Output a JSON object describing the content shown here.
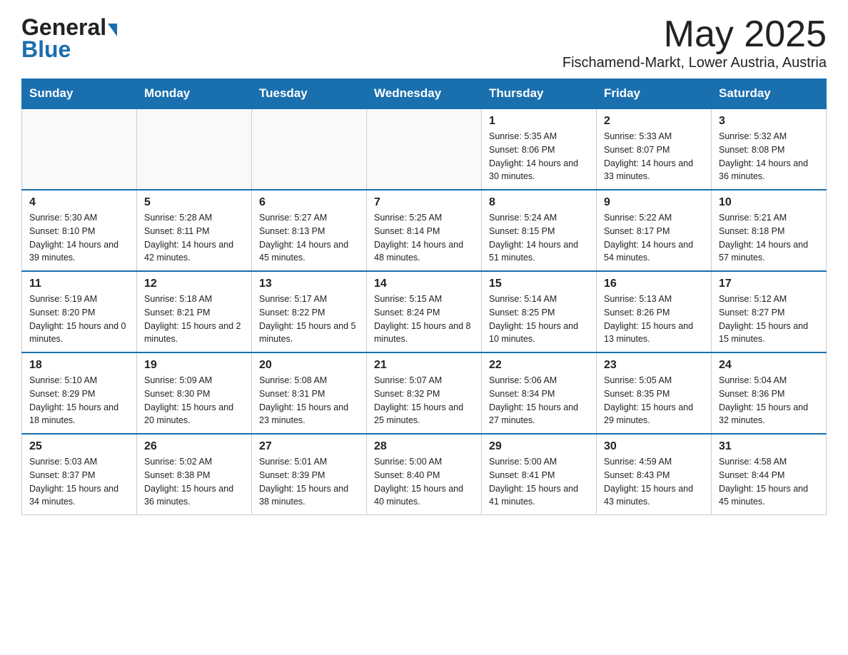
{
  "logo": {
    "general": "General",
    "arrow": "▶",
    "blue": "Blue"
  },
  "header": {
    "month_year": "May 2025",
    "location": "Fischamend-Markt, Lower Austria, Austria"
  },
  "weekdays": [
    "Sunday",
    "Monday",
    "Tuesday",
    "Wednesday",
    "Thursday",
    "Friday",
    "Saturday"
  ],
  "weeks": [
    [
      {
        "day": "",
        "info": ""
      },
      {
        "day": "",
        "info": ""
      },
      {
        "day": "",
        "info": ""
      },
      {
        "day": "",
        "info": ""
      },
      {
        "day": "1",
        "info": "Sunrise: 5:35 AM\nSunset: 8:06 PM\nDaylight: 14 hours and 30 minutes."
      },
      {
        "day": "2",
        "info": "Sunrise: 5:33 AM\nSunset: 8:07 PM\nDaylight: 14 hours and 33 minutes."
      },
      {
        "day": "3",
        "info": "Sunrise: 5:32 AM\nSunset: 8:08 PM\nDaylight: 14 hours and 36 minutes."
      }
    ],
    [
      {
        "day": "4",
        "info": "Sunrise: 5:30 AM\nSunset: 8:10 PM\nDaylight: 14 hours and 39 minutes."
      },
      {
        "day": "5",
        "info": "Sunrise: 5:28 AM\nSunset: 8:11 PM\nDaylight: 14 hours and 42 minutes."
      },
      {
        "day": "6",
        "info": "Sunrise: 5:27 AM\nSunset: 8:13 PM\nDaylight: 14 hours and 45 minutes."
      },
      {
        "day": "7",
        "info": "Sunrise: 5:25 AM\nSunset: 8:14 PM\nDaylight: 14 hours and 48 minutes."
      },
      {
        "day": "8",
        "info": "Sunrise: 5:24 AM\nSunset: 8:15 PM\nDaylight: 14 hours and 51 minutes."
      },
      {
        "day": "9",
        "info": "Sunrise: 5:22 AM\nSunset: 8:17 PM\nDaylight: 14 hours and 54 minutes."
      },
      {
        "day": "10",
        "info": "Sunrise: 5:21 AM\nSunset: 8:18 PM\nDaylight: 14 hours and 57 minutes."
      }
    ],
    [
      {
        "day": "11",
        "info": "Sunrise: 5:19 AM\nSunset: 8:20 PM\nDaylight: 15 hours and 0 minutes."
      },
      {
        "day": "12",
        "info": "Sunrise: 5:18 AM\nSunset: 8:21 PM\nDaylight: 15 hours and 2 minutes."
      },
      {
        "day": "13",
        "info": "Sunrise: 5:17 AM\nSunset: 8:22 PM\nDaylight: 15 hours and 5 minutes."
      },
      {
        "day": "14",
        "info": "Sunrise: 5:15 AM\nSunset: 8:24 PM\nDaylight: 15 hours and 8 minutes."
      },
      {
        "day": "15",
        "info": "Sunrise: 5:14 AM\nSunset: 8:25 PM\nDaylight: 15 hours and 10 minutes."
      },
      {
        "day": "16",
        "info": "Sunrise: 5:13 AM\nSunset: 8:26 PM\nDaylight: 15 hours and 13 minutes."
      },
      {
        "day": "17",
        "info": "Sunrise: 5:12 AM\nSunset: 8:27 PM\nDaylight: 15 hours and 15 minutes."
      }
    ],
    [
      {
        "day": "18",
        "info": "Sunrise: 5:10 AM\nSunset: 8:29 PM\nDaylight: 15 hours and 18 minutes."
      },
      {
        "day": "19",
        "info": "Sunrise: 5:09 AM\nSunset: 8:30 PM\nDaylight: 15 hours and 20 minutes."
      },
      {
        "day": "20",
        "info": "Sunrise: 5:08 AM\nSunset: 8:31 PM\nDaylight: 15 hours and 23 minutes."
      },
      {
        "day": "21",
        "info": "Sunrise: 5:07 AM\nSunset: 8:32 PM\nDaylight: 15 hours and 25 minutes."
      },
      {
        "day": "22",
        "info": "Sunrise: 5:06 AM\nSunset: 8:34 PM\nDaylight: 15 hours and 27 minutes."
      },
      {
        "day": "23",
        "info": "Sunrise: 5:05 AM\nSunset: 8:35 PM\nDaylight: 15 hours and 29 minutes."
      },
      {
        "day": "24",
        "info": "Sunrise: 5:04 AM\nSunset: 8:36 PM\nDaylight: 15 hours and 32 minutes."
      }
    ],
    [
      {
        "day": "25",
        "info": "Sunrise: 5:03 AM\nSunset: 8:37 PM\nDaylight: 15 hours and 34 minutes."
      },
      {
        "day": "26",
        "info": "Sunrise: 5:02 AM\nSunset: 8:38 PM\nDaylight: 15 hours and 36 minutes."
      },
      {
        "day": "27",
        "info": "Sunrise: 5:01 AM\nSunset: 8:39 PM\nDaylight: 15 hours and 38 minutes."
      },
      {
        "day": "28",
        "info": "Sunrise: 5:00 AM\nSunset: 8:40 PM\nDaylight: 15 hours and 40 minutes."
      },
      {
        "day": "29",
        "info": "Sunrise: 5:00 AM\nSunset: 8:41 PM\nDaylight: 15 hours and 41 minutes."
      },
      {
        "day": "30",
        "info": "Sunrise: 4:59 AM\nSunset: 8:43 PM\nDaylight: 15 hours and 43 minutes."
      },
      {
        "day": "31",
        "info": "Sunrise: 4:58 AM\nSunset: 8:44 PM\nDaylight: 15 hours and 45 minutes."
      }
    ]
  ]
}
